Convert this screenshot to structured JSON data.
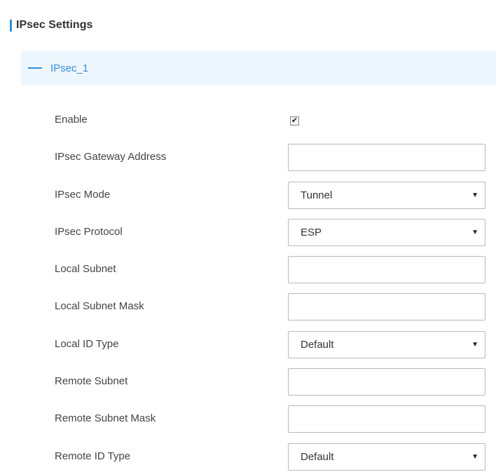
{
  "section": {
    "title": "IPsec Settings"
  },
  "group": {
    "label": "IPsec_1",
    "expanded": true
  },
  "fields": {
    "enable": {
      "label": "Enable",
      "checked": true
    },
    "gateway_address": {
      "label": "IPsec Gateway Address",
      "value": ""
    },
    "mode": {
      "label": "IPsec Mode",
      "value": "Tunnel"
    },
    "protocol": {
      "label": "IPsec Protocol",
      "value": "ESP"
    },
    "local_subnet": {
      "label": "Local Subnet",
      "value": ""
    },
    "local_subnet_mask": {
      "label": "Local Subnet Mask",
      "value": ""
    },
    "local_id_type": {
      "label": "Local ID Type",
      "value": "Default"
    },
    "remote_subnet": {
      "label": "Remote Subnet",
      "value": ""
    },
    "remote_subnet_mask": {
      "label": "Remote Subnet Mask",
      "value": ""
    },
    "remote_id_type": {
      "label": "Remote ID Type",
      "value": "Default"
    }
  },
  "icons": {
    "collapse": "minus-icon",
    "dropdown": "caret-down-icon",
    "check": "checkmark-icon"
  },
  "colors": {
    "accent": "#2f8fd8",
    "group_header_bg": "#eef6fd",
    "border": "#b9b9b9"
  }
}
